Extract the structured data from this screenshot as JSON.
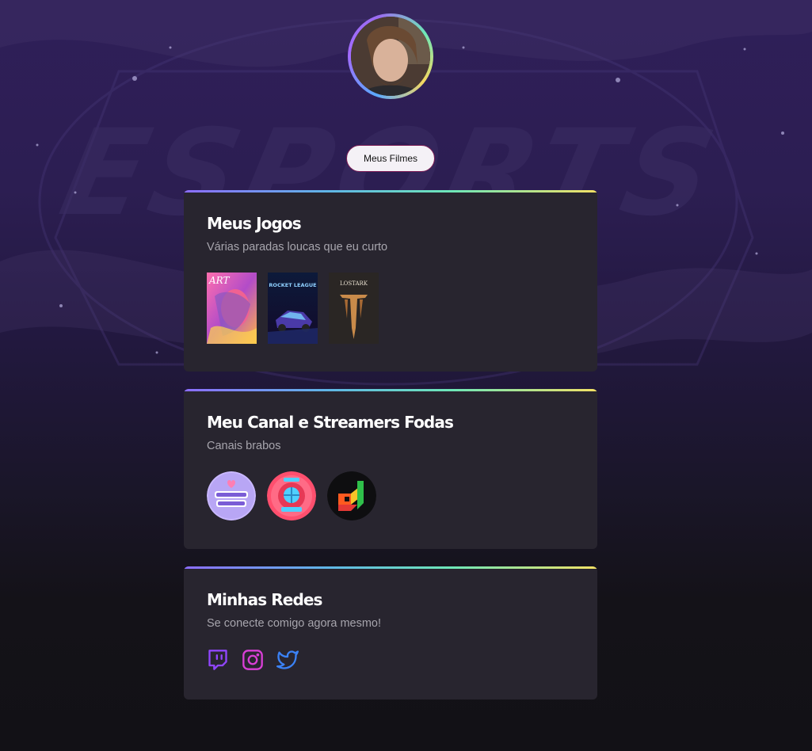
{
  "profile": {
    "avatar_icon": "profile-photo"
  },
  "nav": {
    "movies_button_label": "Meus Filmes"
  },
  "sections": {
    "games": {
      "title": "Meus Jogos",
      "subtitle": "Várias paradas loucas que eu curto",
      "items": [
        {
          "caption": "ART",
          "icon": "game-cover-art"
        },
        {
          "caption": "ROCKET LEAGUE",
          "icon": "game-cover-rocket-league"
        },
        {
          "caption": "LOSTARK",
          "icon": "game-cover-lost-ark"
        }
      ]
    },
    "channels": {
      "title": "Meu Canal e Streamers Fodas",
      "subtitle": "Canais brabos",
      "items": [
        {
          "icon": "double-trouble-channel-logo"
        },
        {
          "icon": "diver-helmet-channel-logo"
        },
        {
          "icon": "colorful-d-channel-logo"
        }
      ]
    },
    "socials": {
      "title": "Minhas Redes",
      "subtitle": "Se conecte comigo agora mesmo!",
      "items": [
        {
          "icon": "twitch-icon",
          "color": "#9146ff"
        },
        {
          "icon": "instagram-icon",
          "color": "#d93fd6"
        },
        {
          "icon": "twitter-icon",
          "color": "#3b82f6"
        }
      ]
    }
  },
  "background": {
    "watermark_text": "ESPORTS"
  },
  "colors": {
    "card_bg": "#28252f",
    "accent_gradient_start": "#8c6dff",
    "accent_gradient_end": "#f3e165"
  }
}
